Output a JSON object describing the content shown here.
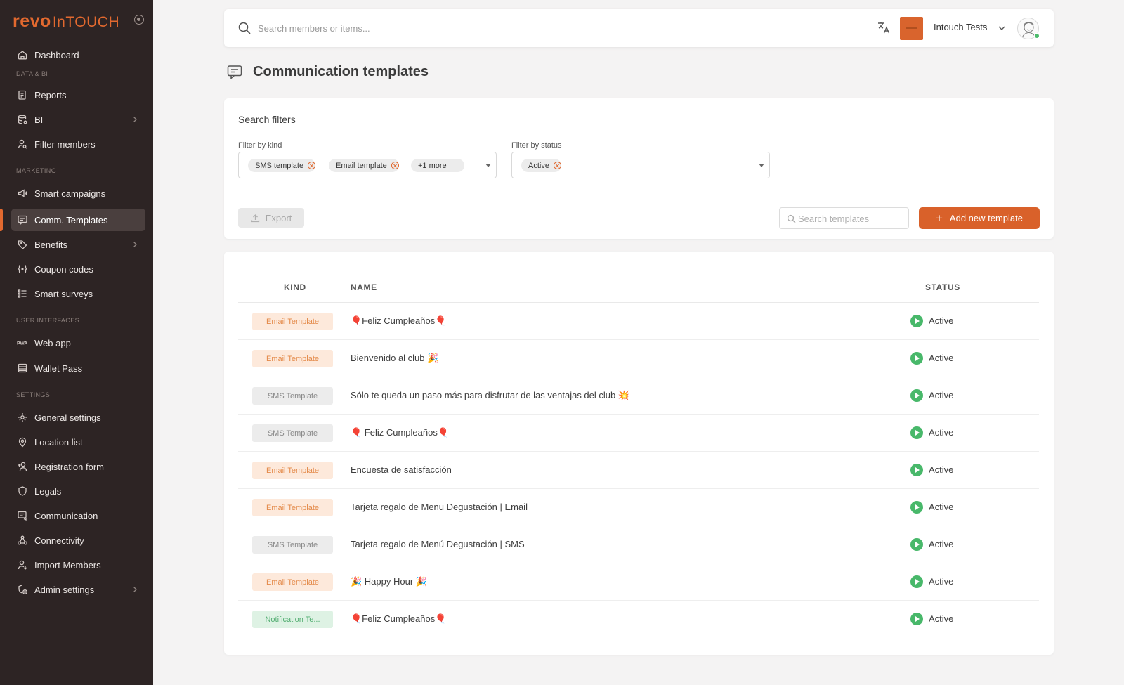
{
  "brand": {
    "part1": "revo",
    "part2": "InTOUCH",
    "accent": "#e2692f"
  },
  "sidebar": {
    "sections": {
      "data_bi": "DATA & BI",
      "marketing": "MARKETING",
      "user_interfaces": "USER INTERFACES",
      "settings": "SETTINGS"
    },
    "items": [
      {
        "label": "Dashboard",
        "icon": "home-icon"
      },
      {
        "label": "Reports",
        "icon": "reports-icon"
      },
      {
        "label": "BI",
        "icon": "database-icon",
        "expandable": true
      },
      {
        "label": "Filter members",
        "icon": "user-search-icon"
      },
      {
        "label": "Smart campaigns",
        "icon": "megaphone-icon"
      },
      {
        "label": "Comm. Templates",
        "icon": "message-icon",
        "active": true
      },
      {
        "label": "Benefits",
        "icon": "tag-icon",
        "expandable": true
      },
      {
        "label": "Coupon codes",
        "icon": "braces-icon"
      },
      {
        "label": "Smart surveys",
        "icon": "list-icon"
      },
      {
        "label": "Web app",
        "icon": "pwa-icon"
      },
      {
        "label": "Wallet Pass",
        "icon": "wallet-icon"
      },
      {
        "label": "General settings",
        "icon": "gear-icon"
      },
      {
        "label": "Location list",
        "icon": "location-pin-icon"
      },
      {
        "label": "Registration form",
        "icon": "user-plus-icon"
      },
      {
        "label": "Legals",
        "icon": "shield-icon"
      },
      {
        "label": "Communication",
        "icon": "communication-icon"
      },
      {
        "label": "Connectivity",
        "icon": "connectivity-icon"
      },
      {
        "label": "Import Members",
        "icon": "user-import-icon"
      },
      {
        "label": "Admin settings",
        "icon": "admin-icon",
        "expandable": true
      }
    ]
  },
  "topbar": {
    "search_placeholder": "Search members or items...",
    "org_name": "Intouch Tests"
  },
  "page": {
    "title": "Communication templates"
  },
  "filters": {
    "title": "Search filters",
    "kind": {
      "label": "Filter by kind",
      "chips": [
        "SMS template",
        "Email template"
      ],
      "more": "+1 more"
    },
    "status": {
      "label": "Filter by status",
      "chips": [
        "Active"
      ]
    },
    "export_label": "Export",
    "search_placeholder": "Search templates",
    "add_label": "Add new template"
  },
  "table": {
    "columns": {
      "kind": "KIND",
      "name": "NAME",
      "status": "STATUS"
    },
    "rows": [
      {
        "kind": "Email Template",
        "kind_type": "email",
        "name": "🎈Feliz Cumpleaños🎈",
        "status": "Active"
      },
      {
        "kind": "Email Template",
        "kind_type": "email",
        "name": "Bienvenido al club 🎉",
        "status": "Active"
      },
      {
        "kind": "SMS Template",
        "kind_type": "sms",
        "name": "Sólo te queda un paso más para disfrutar de las ventajas del club 💥",
        "status": "Active"
      },
      {
        "kind": "SMS Template",
        "kind_type": "sms",
        "name": "🎈 Feliz Cumpleaños🎈",
        "status": "Active"
      },
      {
        "kind": "Email Template",
        "kind_type": "email",
        "name": "Encuesta de satisfacción",
        "status": "Active"
      },
      {
        "kind": "Email Template",
        "kind_type": "email",
        "name": "Tarjeta regalo de Menu Degustación | Email",
        "status": "Active"
      },
      {
        "kind": "SMS Template",
        "kind_type": "sms",
        "name": "Tarjeta regalo de Menú Degustación | SMS",
        "status": "Active"
      },
      {
        "kind": "Email Template",
        "kind_type": "email",
        "name": "🎉 Happy Hour 🎉",
        "status": "Active"
      },
      {
        "kind": "Notification Te...",
        "kind_type": "notification",
        "name": "🎈Feliz Cumpleaños🎈",
        "status": "Active"
      }
    ]
  },
  "colors": {
    "accent": "#d9612a",
    "sidebar_bg": "#2d2424",
    "status_active": "#48b86a"
  }
}
